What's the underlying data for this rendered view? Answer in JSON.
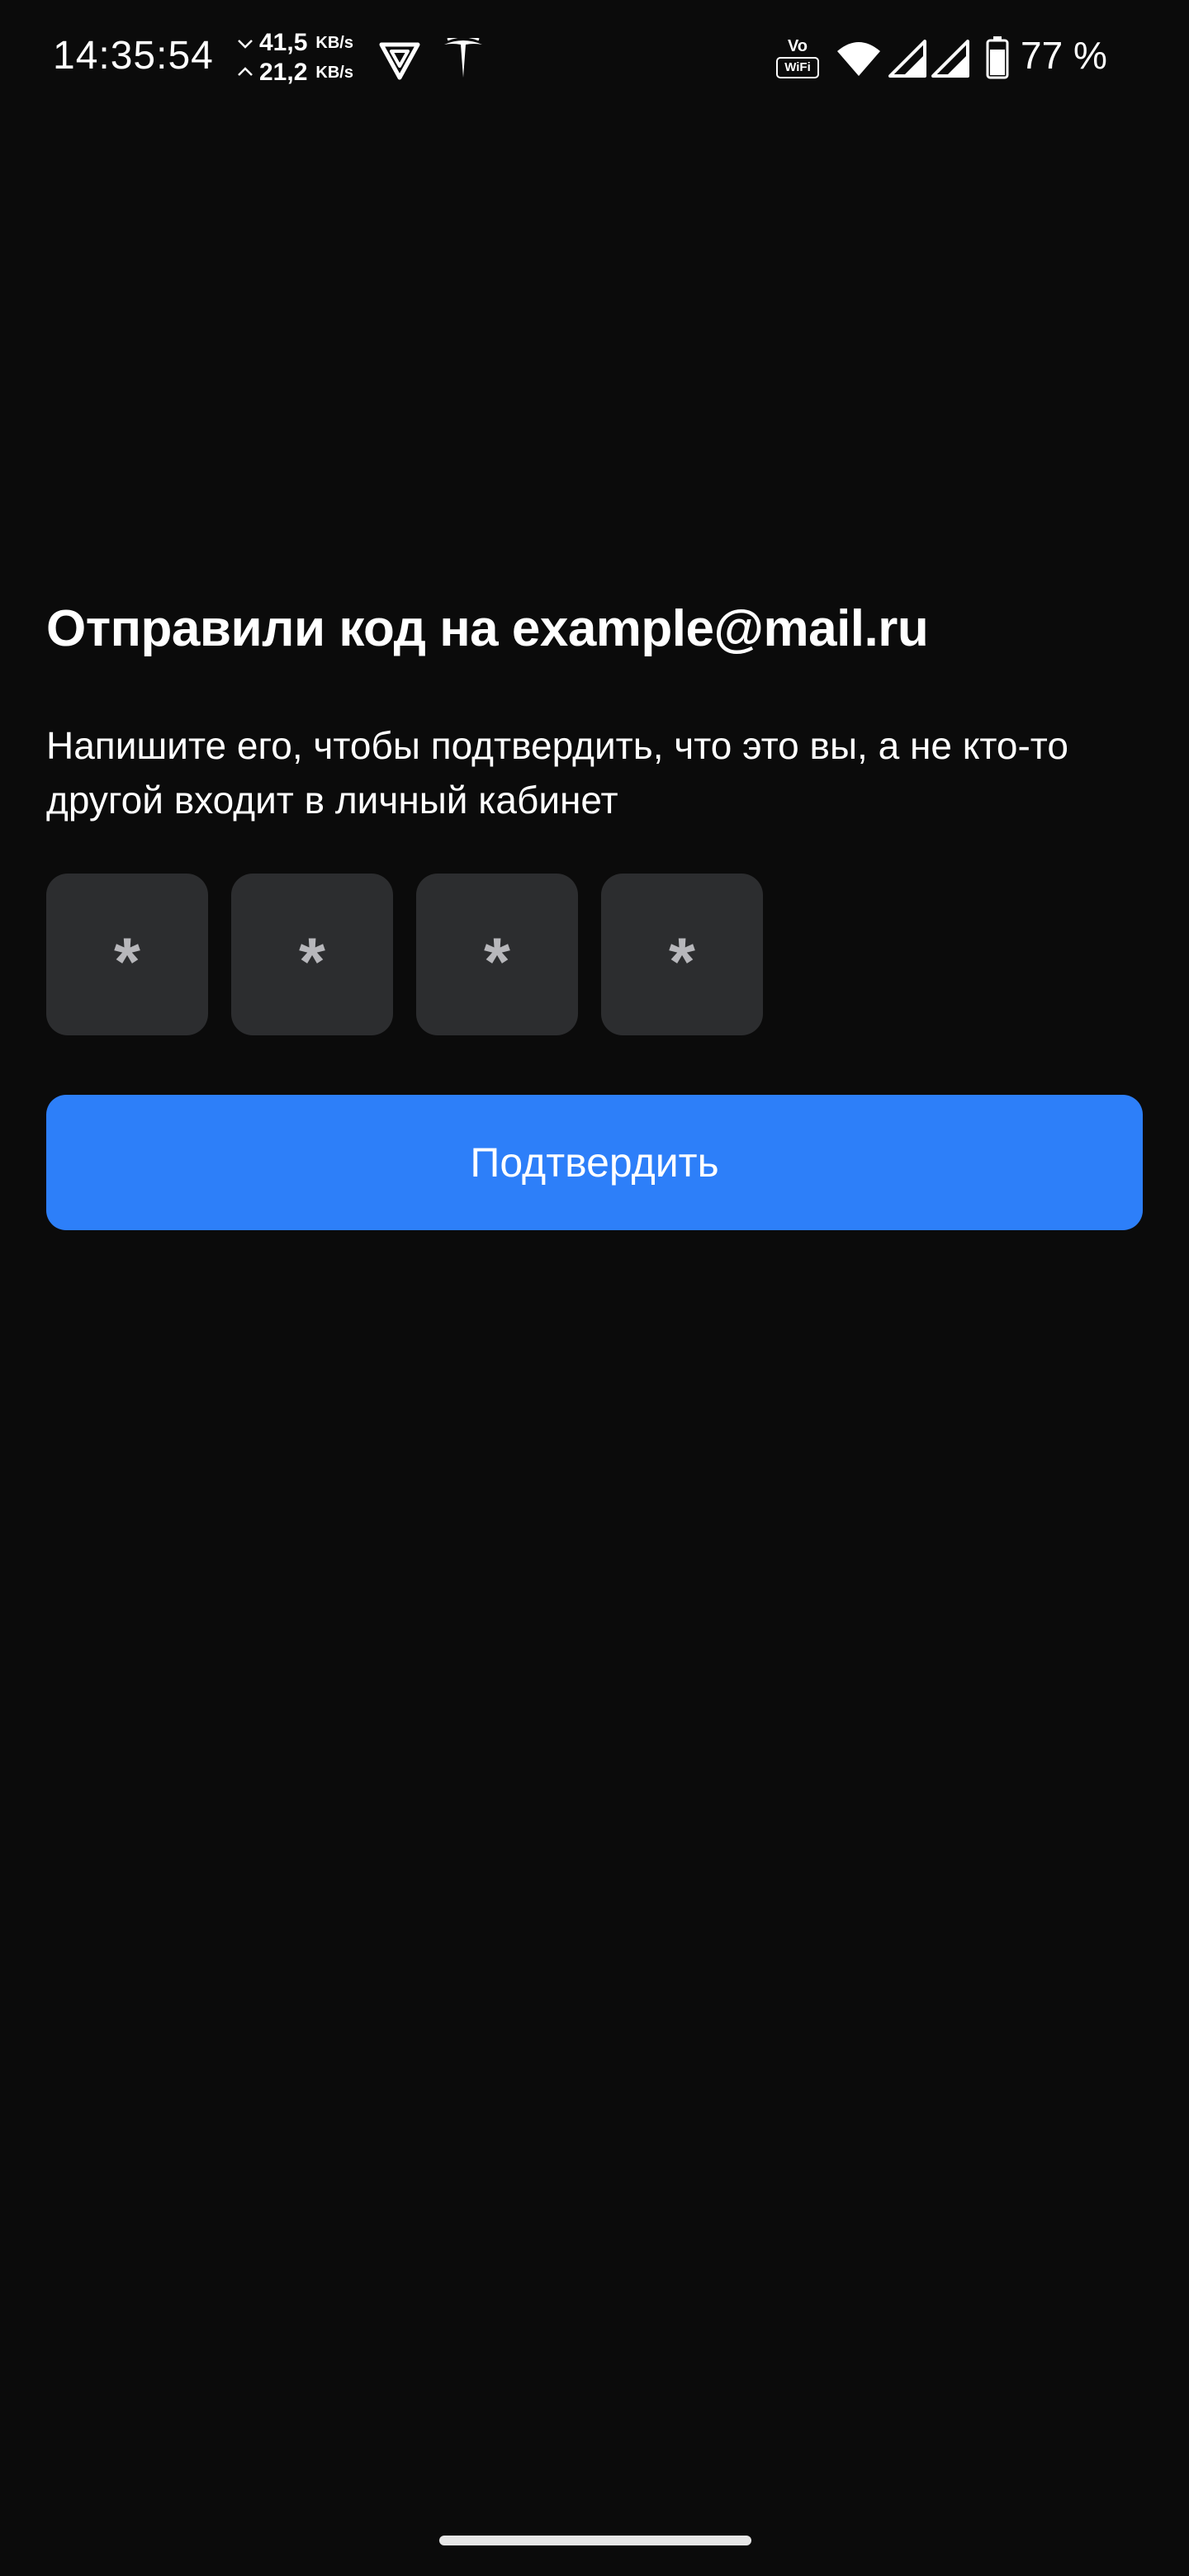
{
  "status_bar": {
    "time": "14:35:54",
    "download_speed": "41,5",
    "upload_speed": "21,2",
    "speed_unit": "KB/s",
    "battery_percent": "77 %",
    "vowifi_top": "Vo",
    "vowifi_bottom": "WiFi",
    "icons": [
      "download-arrow-icon",
      "upload-arrow-icon",
      "vpn-shield-icon",
      "tesla-logo-icon",
      "vowifi-icon",
      "wifi-icon",
      "signal-icon",
      "signal-icon",
      "battery-icon"
    ]
  },
  "verification": {
    "title": "Отправили код на example@mail.ru",
    "subtitle": "Напишите его, чтобы подтвердить, что это вы, а не кто-то другой входит в личный кабинет",
    "code_cells": [
      "*",
      "*",
      "*",
      "*"
    ],
    "confirm_label": "Подтвердить"
  },
  "colors": {
    "background": "#0b0b0b",
    "cell_background": "#2c2d2f",
    "accent": "#2d7ff9"
  }
}
